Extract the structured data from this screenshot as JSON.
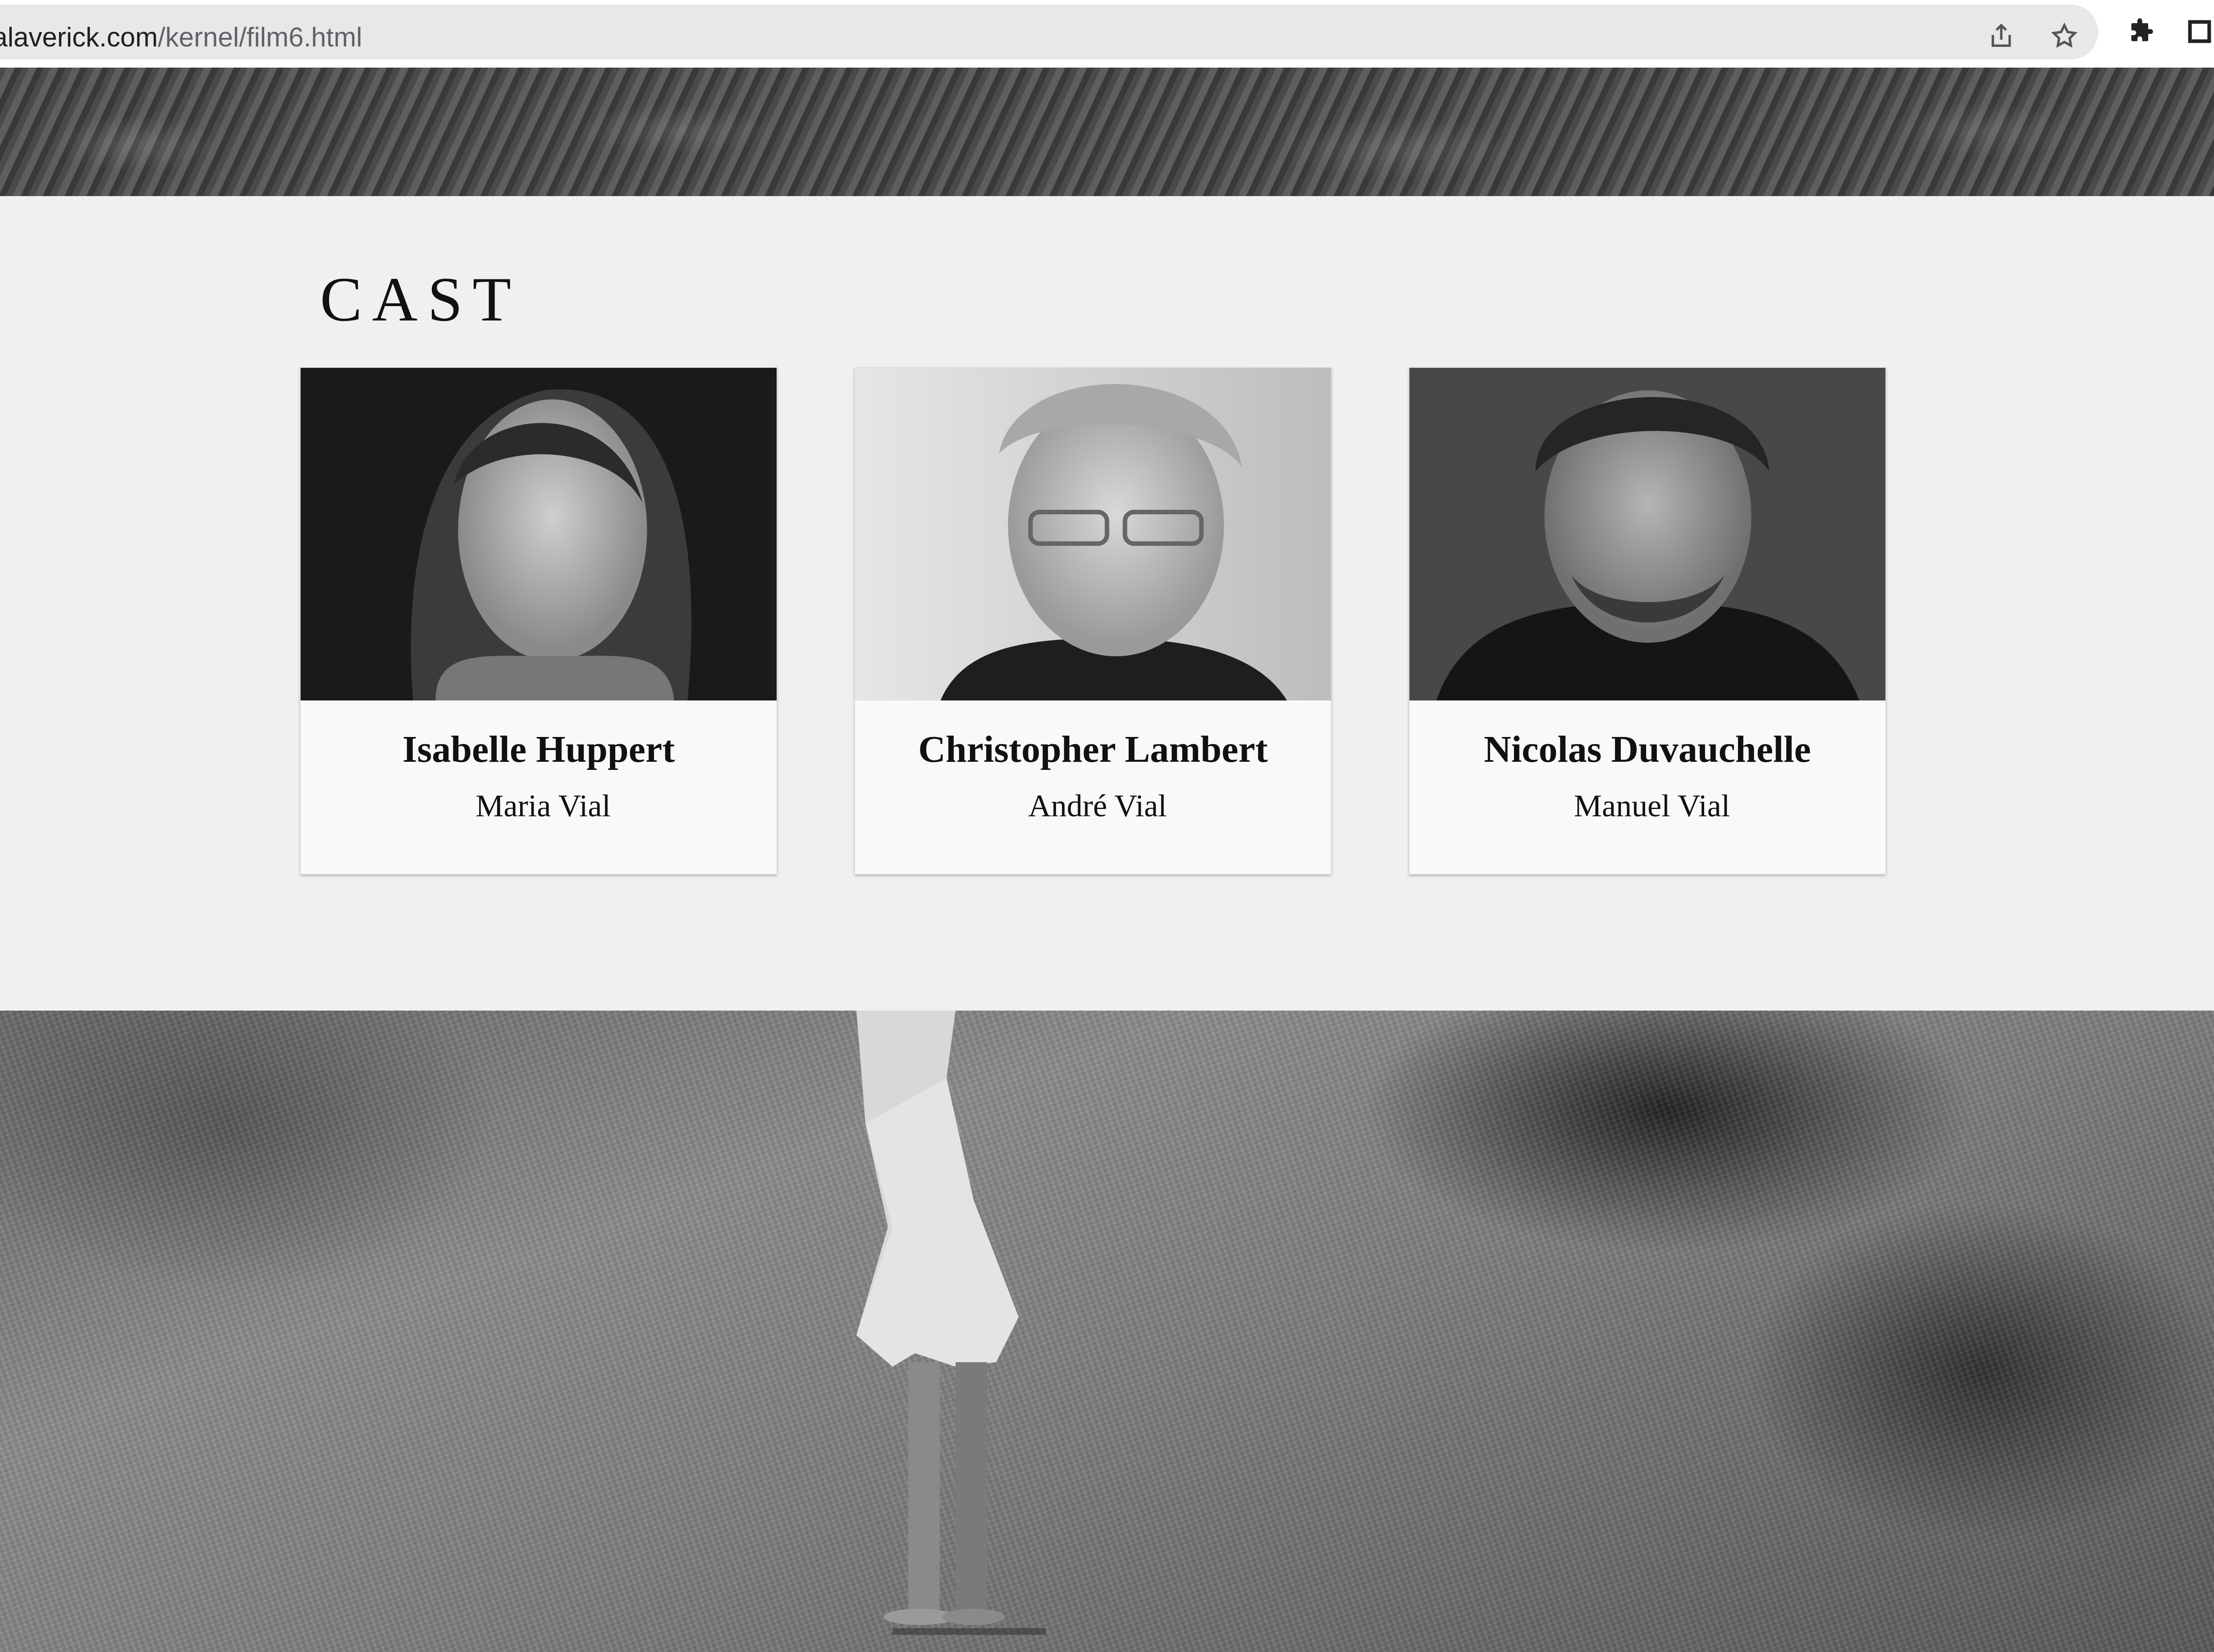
{
  "browser": {
    "url_host": "eyalaverick.com",
    "url_path": "/kernel/film6.html",
    "icons": [
      "share-icon",
      "bookmark-star-icon",
      "extensions-puzzle-icon",
      "side-panel-icon"
    ]
  },
  "cast": {
    "heading": "CAST",
    "members": [
      {
        "actor": "Isabelle Huppert",
        "role": "Maria Vial"
      },
      {
        "actor": "Christopher Lambert",
        "role": "André Vial"
      },
      {
        "actor": "Nicolas Duvauchelle",
        "role": "Manuel Vial"
      }
    ]
  },
  "colors": {
    "section_background": "#f0f0f0",
    "card_background": "#f9f9f9",
    "text": "#111111"
  }
}
